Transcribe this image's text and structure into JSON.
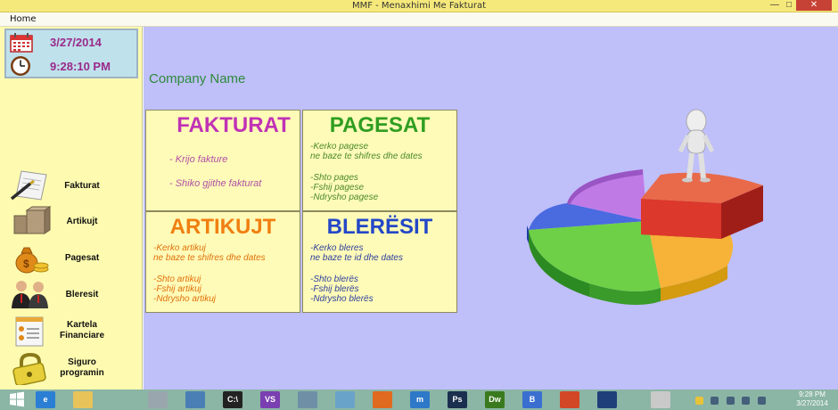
{
  "window": {
    "title": "MMF - Menaxhimi Me Fakturat",
    "minimize_glyph": "—",
    "maximize_glyph": "□",
    "close_glyph": "✕"
  },
  "menu": {
    "home": "Home"
  },
  "clock_panel": {
    "date": "3/27/2014",
    "time": "9:28:10 PM"
  },
  "sidebar": {
    "items": [
      {
        "label": "Fakturat",
        "icon": "invoice-pen-icon"
      },
      {
        "label": "Artikujt",
        "icon": "boxes-icon"
      },
      {
        "label": "Pagesat",
        "icon": "money-bag-icon"
      },
      {
        "label": "Bleresit",
        "icon": "people-icon"
      },
      {
        "label": "Kartela Financiare",
        "icon": "financial-card-icon"
      },
      {
        "label": "Siguro programin",
        "icon": "padlock-icon"
      }
    ]
  },
  "main": {
    "company_name": "Company Name",
    "cards": {
      "fakturat": {
        "title": "FAKTURAT",
        "lines": [
          "- Krijo fakture",
          "- Shiko gjithe fakturat"
        ]
      },
      "pagesat": {
        "title": "PAGESAT",
        "lines": [
          "-Kerko pagese",
          "ne baze te shifres dhe dates",
          "-Shto pages",
          "-Fshij pagese",
          "-Ndrysho pagese"
        ]
      },
      "artikujt": {
        "title": "ARTIKUJT",
        "lines": [
          "-Kerko artikuj",
          "ne baze te shifres dhe dates",
          "-Shto artikuj",
          "-Fshij artikuj",
          "-Ndrysho artikuj"
        ]
      },
      "bleresit": {
        "title": "BLERËSIT",
        "lines": [
          "-Kerko bleres",
          "ne baze te id dhe dates",
          "-Shto blerës",
          "-Fshij blerës",
          "-Ndrysho blerës"
        ]
      }
    }
  },
  "taskbar": {
    "time": "9:28 PM",
    "date": "3/27/2014",
    "apps": [
      {
        "icon": "ie-icon",
        "text": "e",
        "color": "#2a7fd4"
      },
      {
        "icon": "explorer-icon",
        "text": "",
        "color": "#e8c35a"
      },
      {
        "icon": "scanner-icon",
        "text": "",
        "color": "#9aa6ad"
      },
      {
        "icon": "remote-desktop-icon",
        "text": "",
        "color": "#4a7fb5"
      },
      {
        "icon": "cmd-icon",
        "text": "C:\\",
        "color": "#222222"
      },
      {
        "icon": "visual-studio-icon",
        "text": "VS",
        "color": "#7a3fb0"
      },
      {
        "icon": "calculator-icon",
        "text": "",
        "color": "#6f8fa6"
      },
      {
        "icon": "notepad-icon",
        "text": "",
        "color": "#6aa3c9"
      },
      {
        "icon": "firefox-icon",
        "text": "",
        "color": "#e06a1f"
      },
      {
        "icon": "maxthon-icon",
        "text": "m",
        "color": "#2e78c8"
      },
      {
        "icon": "photoshop-icon",
        "text": "Ps",
        "color": "#1b2f4e"
      },
      {
        "icon": "dreamweaver-icon",
        "text": "Dw",
        "color": "#3a7a1e"
      },
      {
        "icon": "bootstrap-icon",
        "text": "B",
        "color": "#3a6fd0"
      },
      {
        "icon": "powerpoint-icon",
        "text": "",
        "color": "#d24726"
      },
      {
        "icon": "vs-code-icon",
        "text": "",
        "color": "#1f3f7a"
      },
      {
        "icon": "printer-icon",
        "text": "",
        "color": "#c9c9c9"
      }
    ]
  },
  "colors": {
    "sidebar_bg": "#fefbb0",
    "main_bg": "#bfbffa",
    "title_bg": "#f6e97b",
    "fakturat": "#c032b6",
    "pagesat": "#2f9e21",
    "artikujt": "#f07f11",
    "bleresit": "#2447c8",
    "company": "#2e8b3a"
  }
}
